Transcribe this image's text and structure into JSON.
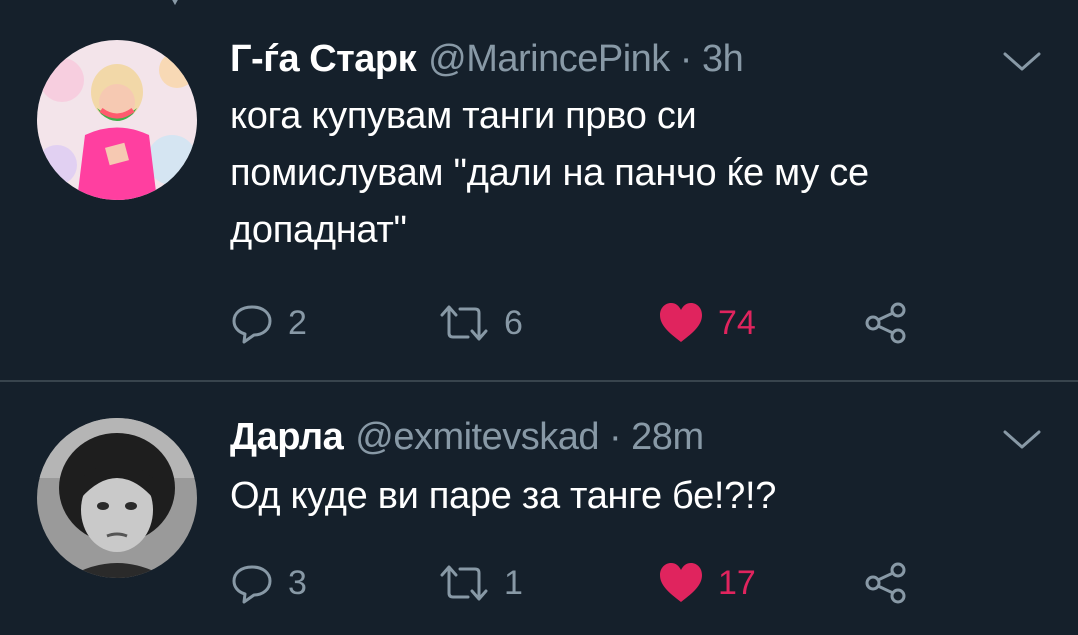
{
  "colors": {
    "background": "#15202b",
    "text": "#ffffff",
    "muted": "#8899a6",
    "like": "#e0245e",
    "divider": "#38444d"
  },
  "tweets": [
    {
      "display_name": "Г-ѓа Старк",
      "handle": "@MarincePink",
      "separator": "·",
      "time": "3h",
      "text_lines": [
        "кога купувам танги прво си",
        "помислувам \"дали на панчо ќе му се",
        "допаднат\""
      ],
      "replies": "2",
      "retweets": "6",
      "likes": "74",
      "liked": true,
      "icons": {
        "reply": "reply-icon",
        "retweet": "retweet-icon",
        "like": "heart-filled-icon",
        "share": "share-icon",
        "menu": "chevron-down-icon"
      }
    },
    {
      "display_name": "Дарла",
      "handle": "@exmitevskad",
      "separator": "·",
      "time": "28m",
      "text_lines": [
        "Од куде ви паре за танге бе!?!?"
      ],
      "replies": "3",
      "retweets": "1",
      "likes": "17",
      "liked": true,
      "icons": {
        "reply": "reply-icon",
        "retweet": "retweet-icon",
        "like": "heart-filled-icon",
        "share": "share-icon",
        "menu": "chevron-down-icon"
      }
    }
  ]
}
